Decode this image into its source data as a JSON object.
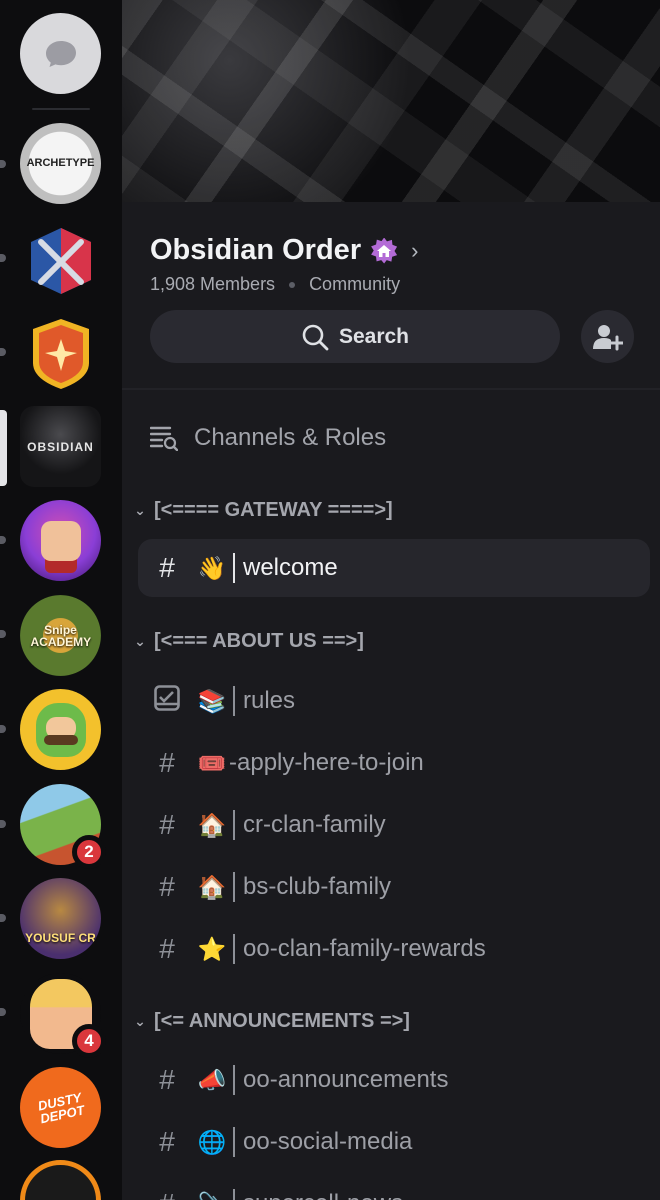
{
  "server": {
    "name": "Obsidian Order",
    "members": "1,908 Members",
    "type": "Community"
  },
  "search": {
    "label": "Search"
  },
  "channels_roles": "Channels & Roles",
  "rail": {
    "servers": [
      {
        "label": "ARCHETYPE",
        "colors": [
          "#e8e8e8",
          "#2c2c2c"
        ]
      },
      {
        "label": "",
        "colors": [
          "#d8344a",
          "#2b57a6"
        ]
      },
      {
        "label": "",
        "colors": [
          "#f0b424",
          "#e0592a"
        ]
      },
      {
        "label": "OBSIDIAN",
        "colors": [
          "#3a3a3a",
          "#0f0f0f"
        ]
      },
      {
        "label": "",
        "colors": [
          "#8a3ed6",
          "#d14fb3"
        ]
      },
      {
        "label": "Snipe ACADEMY",
        "colors": [
          "#d8a53a",
          "#2f4a1e"
        ]
      },
      {
        "label": "",
        "colors": [
          "#f3c12c",
          "#5a3a20"
        ]
      },
      {
        "label": "",
        "colors": [
          "#7ab34a",
          "#c7542f"
        ],
        "badge": "2"
      },
      {
        "label": "YOUSUF CR",
        "colors": [
          "#b88942",
          "#4a2f6e"
        ]
      },
      {
        "label": "",
        "colors": [
          "#f3c860",
          "#7b4a22"
        ],
        "badge": "4"
      },
      {
        "label": "DUSTY DEPOT",
        "colors": [
          "#f06a1d",
          "#c84d10"
        ]
      },
      {
        "label": "",
        "colors": [
          "#222",
          "#f08a18"
        ]
      }
    ]
  },
  "categories": [
    {
      "name": "[<==== GATEWAY ====>]",
      "channels": [
        {
          "name": "welcome",
          "emoji": "👋",
          "icon": "hash",
          "selected": true
        }
      ]
    },
    {
      "name": "[<=== ABOUT US ==>]",
      "channels": [
        {
          "name": "rules",
          "emoji": "📚",
          "icon": "rules-checkbox"
        },
        {
          "name": "-apply-here-to-join",
          "emoji": "🎟️",
          "icon": "hash"
        },
        {
          "name": "cr-clan-family",
          "emoji": "🏠",
          "icon": "hash"
        },
        {
          "name": "bs-club-family",
          "emoji": "🏠",
          "icon": "hash"
        },
        {
          "name": "oo-clan-family-rewards",
          "emoji": "⭐",
          "icon": "hash"
        }
      ]
    },
    {
      "name": "[<= ANNOUNCEMENTS =>]",
      "channels": [
        {
          "name": "oo-announcements",
          "emoji": "📣",
          "icon": "hash"
        },
        {
          "name": "oo-social-media",
          "emoji": "🌐",
          "icon": "hash"
        },
        {
          "name": "supercell-news",
          "emoji": "📎",
          "icon": "hash"
        }
      ]
    }
  ],
  "colors": {
    "boost": "#b36bd6",
    "badge": "#da373c",
    "selected_bg": "#26262c"
  }
}
